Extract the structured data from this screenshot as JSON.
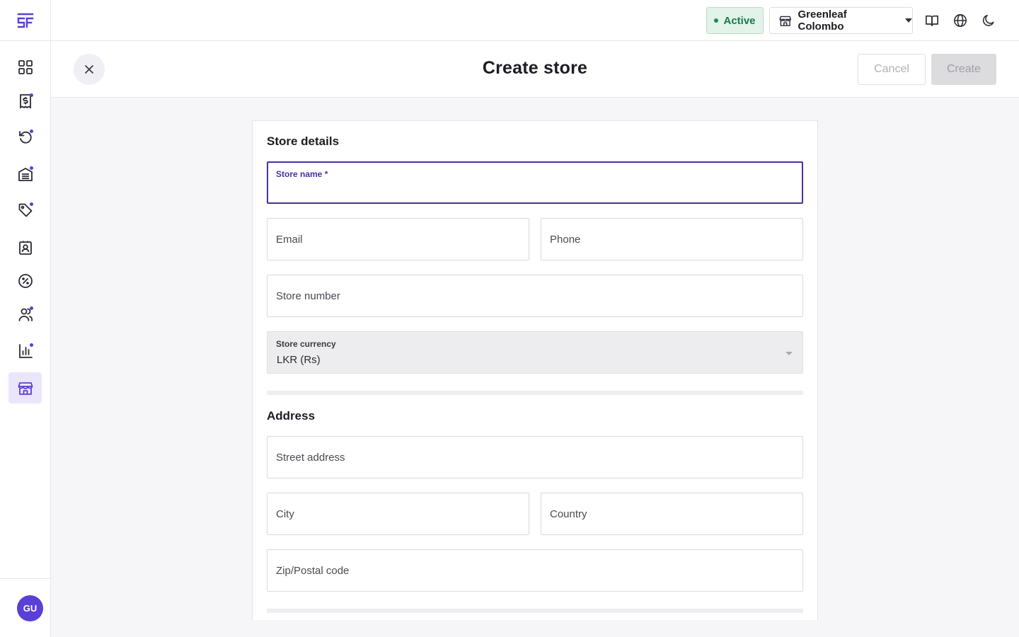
{
  "app": {
    "logo_text": "SF"
  },
  "sidebar": {
    "items": [
      {
        "name": "dashboard",
        "icon": "grid-icon",
        "dot": false,
        "active": false
      },
      {
        "name": "sales",
        "icon": "invoice-dollar-icon",
        "dot": true,
        "active": false
      },
      {
        "name": "returns",
        "icon": "refresh-icon",
        "dot": true,
        "active": false
      },
      {
        "name": "inventory",
        "icon": "warehouse-icon",
        "dot": true,
        "active": false
      },
      {
        "name": "products",
        "icon": "tag-icon",
        "dot": true,
        "active": false
      },
      {
        "name": "contacts",
        "icon": "contact-card-icon",
        "dot": false,
        "active": false
      },
      {
        "name": "discounts",
        "icon": "percent-badge-icon",
        "dot": false,
        "active": false
      },
      {
        "name": "users",
        "icon": "users-icon",
        "dot": true,
        "active": false
      },
      {
        "name": "reports",
        "icon": "bar-chart-icon",
        "dot": true,
        "active": false
      },
      {
        "name": "stores",
        "icon": "store-icon",
        "dot": false,
        "active": true
      }
    ],
    "avatar_initials": "GU"
  },
  "topbar": {
    "status_label": "Active",
    "store_name": "Greenleaf Colombo",
    "icons": [
      "book-icon",
      "globe-icon",
      "moon-icon"
    ]
  },
  "header": {
    "title": "Create store",
    "cancel_label": "Cancel",
    "create_label": "Create"
  },
  "form": {
    "store_details_title": "Store details",
    "store_name_label": "Store name *",
    "email_placeholder": "Email",
    "phone_placeholder": "Phone",
    "store_number_placeholder": "Store number",
    "currency_label": "Store currency",
    "currency_value": "LKR (Rs)",
    "address_title": "Address",
    "street_placeholder": "Street address",
    "city_placeholder": "City",
    "country_placeholder": "Country",
    "zip_placeholder": "Zip/Postal code"
  },
  "colors": {
    "accent": "#5b3fd6",
    "focus": "#4c2f9e",
    "active_badge_bg": "#e3f3ea",
    "active_badge_text": "#147a46"
  }
}
